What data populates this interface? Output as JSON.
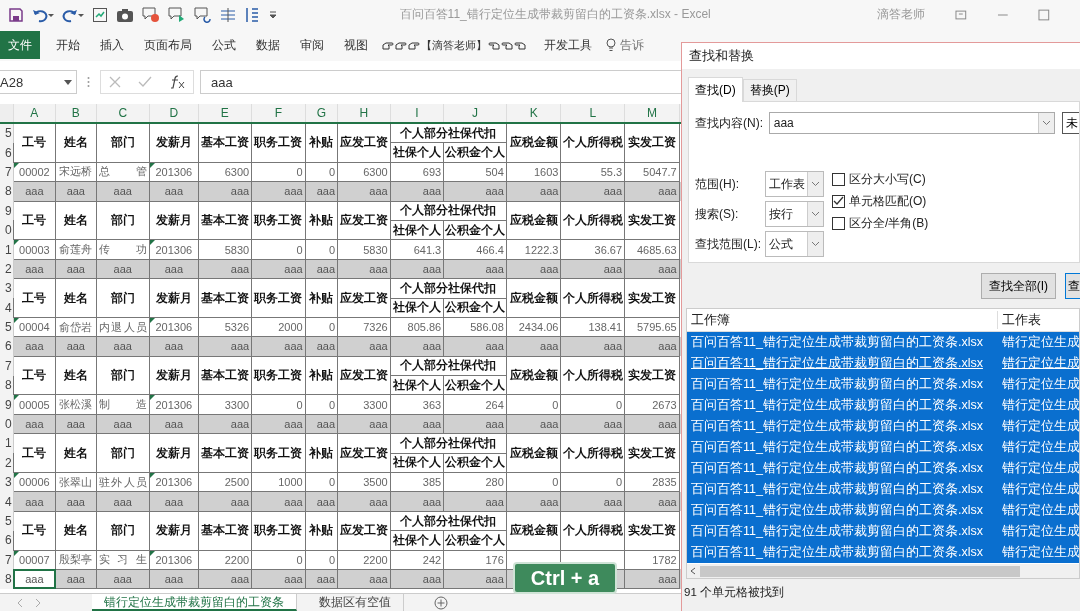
{
  "title_bar": {
    "file_title": "百问百答11_错行定位生成带裁剪留白的工资条.xlsx  -  Excel",
    "user": "滴答老师"
  },
  "ribbon_tabs": [
    {
      "label": "文件",
      "kind": "file"
    },
    {
      "label": "开始",
      "kind": "plain"
    },
    {
      "label": "插入",
      "kind": "plain"
    },
    {
      "label": "页面布局",
      "kind": "plain"
    },
    {
      "label": "公式",
      "kind": "plain"
    },
    {
      "label": "数据",
      "kind": "plain"
    },
    {
      "label": "审阅",
      "kind": "plain"
    },
    {
      "label": "视图",
      "kind": "plain"
    },
    {
      "label": "【滴答老师】",
      "kind": "custom"
    },
    {
      "label": "开发工具",
      "kind": "plain"
    },
    {
      "label": "告诉",
      "kind": "search"
    }
  ],
  "formula_bar": {
    "name_box": "A28",
    "formula": "aaa"
  },
  "sheet": {
    "columns": [
      "A",
      "B",
      "C",
      "D",
      "E",
      "F",
      "G",
      "H",
      "I",
      "J",
      "K",
      "L",
      "M"
    ],
    "blocks": [
      {
        "row_numbers": [
          "5",
          "6",
          "7",
          "8"
        ],
        "header_top": [
          "工号",
          "姓名",
          "部门",
          "发薪月",
          "基本工资",
          "职务工资",
          "补贴",
          "应发工资",
          "个人部分社保代扣",
          "应税金额",
          "个人所得税",
          "实发工资"
        ],
        "header_bottom": [
          "社保个人",
          "公积金个人"
        ],
        "data": {
          "A": "00002",
          "B": "宋远桥",
          "C": "总管",
          "D": "201306",
          "E": "6300",
          "F": "0",
          "G": "0",
          "H": "6300",
          "I": "693",
          "J": "504",
          "K": "1603",
          "L": "55.3",
          "M": "5047.7"
        },
        "filler": {
          "A": "aaa",
          "B": "aaa",
          "C": "aaa",
          "D": "aaa",
          "E": "aaa",
          "F": "aaa",
          "G": "aaa",
          "H": "aaa",
          "I": "aaa",
          "J": "aaa",
          "K": "aaa",
          "L": "aaa",
          "M": "aaa"
        },
        "filler_first_selected": false
      },
      {
        "row_numbers": [
          "9",
          "0",
          "1",
          "2"
        ],
        "header_top": [
          "工号",
          "姓名",
          "部门",
          "发薪月",
          "基本工资",
          "职务工资",
          "补贴",
          "应发工资",
          "个人部分社保代扣",
          "应税金额",
          "个人所得税",
          "实发工资"
        ],
        "header_bottom": [
          "社保个人",
          "公积金个人"
        ],
        "data": {
          "A": "00003",
          "B": "俞莲舟",
          "C": "传功",
          "D": "201306",
          "E": "5830",
          "F": "0",
          "G": "0",
          "H": "5830",
          "I": "641.3",
          "J": "466.4",
          "K": "1222.3",
          "L": "36.67",
          "M": "4685.63"
        },
        "filler": {
          "A": "aaa",
          "B": "aaa",
          "C": "aaa",
          "D": "aaa",
          "E": "aaa",
          "F": "aaa",
          "G": "aaa",
          "H": "aaa",
          "I": "aaa",
          "J": "aaa",
          "K": "aaa",
          "L": "aaa",
          "M": "aaa"
        },
        "filler_first_selected": false
      },
      {
        "row_numbers": [
          "3",
          "4",
          "5",
          "6"
        ],
        "header_top": [
          "工号",
          "姓名",
          "部门",
          "发薪月",
          "基本工资",
          "职务工资",
          "补贴",
          "应发工资",
          "个人部分社保代扣",
          "应税金额",
          "个人所得税",
          "实发工资"
        ],
        "header_bottom": [
          "社保个人",
          "公积金个人"
        ],
        "data": {
          "A": "00004",
          "B": "俞岱岩",
          "C": "内退人员",
          "D": "201306",
          "E": "5326",
          "F": "2000",
          "G": "0",
          "H": "7326",
          "I": "805.86",
          "J": "586.08",
          "K": "2434.06",
          "L": "138.41",
          "M": "5795.65"
        },
        "filler": {
          "A": "aaa",
          "B": "aaa",
          "C": "aaa",
          "D": "aaa",
          "E": "aaa",
          "F": "aaa",
          "G": "aaa",
          "H": "aaa",
          "I": "aaa",
          "J": "aaa",
          "K": "aaa",
          "L": "aaa",
          "M": "aaa"
        },
        "filler_first_selected": false
      },
      {
        "row_numbers": [
          "7",
          "8",
          "9",
          "0"
        ],
        "header_top": [
          "工号",
          "姓名",
          "部门",
          "发薪月",
          "基本工资",
          "职务工资",
          "补贴",
          "应发工资",
          "个人部分社保代扣",
          "应税金额",
          "个人所得税",
          "实发工资"
        ],
        "header_bottom": [
          "社保个人",
          "公积金个人"
        ],
        "data": {
          "A": "00005",
          "B": "张松溪",
          "C": "制造",
          "D": "201306",
          "E": "3300",
          "F": "0",
          "G": "0",
          "H": "3300",
          "I": "363",
          "J": "264",
          "K": "0",
          "L": "0",
          "M": "2673"
        },
        "filler": {
          "A": "aaa",
          "B": "aaa",
          "C": "aaa",
          "D": "aaa",
          "E": "aaa",
          "F": "aaa",
          "G": "aaa",
          "H": "aaa",
          "I": "aaa",
          "J": "aaa",
          "K": "aaa",
          "L": "aaa",
          "M": "aaa"
        },
        "filler_first_selected": false
      },
      {
        "row_numbers": [
          "1",
          "2",
          "3",
          "4"
        ],
        "header_top": [
          "工号",
          "姓名",
          "部门",
          "发薪月",
          "基本工资",
          "职务工资",
          "补贴",
          "应发工资",
          "个人部分社保代扣",
          "应税金额",
          "个人所得税",
          "实发工资"
        ],
        "header_bottom": [
          "社保个人",
          "公积金个人"
        ],
        "data": {
          "A": "00006",
          "B": "张翠山",
          "C": "驻外人员",
          "D": "201306",
          "E": "2500",
          "F": "1000",
          "G": "0",
          "H": "3500",
          "I": "385",
          "J": "280",
          "K": "0",
          "L": "0",
          "M": "2835"
        },
        "filler": {
          "A": "aaa",
          "B": "aaa",
          "C": "aaa",
          "D": "aaa",
          "E": "aaa",
          "F": "aaa",
          "G": "aaa",
          "H": "aaa",
          "I": "aaa",
          "J": "aaa",
          "K": "aaa",
          "L": "aaa",
          "M": "aaa"
        },
        "filler_first_selected": false
      },
      {
        "row_numbers": [
          "5",
          "6",
          "7",
          "8"
        ],
        "header_top": [
          "工号",
          "姓名",
          "部门",
          "发薪月",
          "基本工资",
          "职务工资",
          "补贴",
          "应发工资",
          "个人部分社保代扣",
          "应税金额",
          "个人所得税",
          "实发工资"
        ],
        "header_bottom": [
          "社保个人",
          "公积金个人"
        ],
        "data": {
          "A": "00007",
          "B": "殷梨亭",
          "C": "实习生",
          "D": "201306",
          "E": "2200",
          "F": "0",
          "G": "0",
          "H": "2200",
          "I": "242",
          "J": "176",
          "M": "1782"
        },
        "filler": {
          "A": "aaa",
          "B": "aaa",
          "C": "aaa",
          "D": "aaa",
          "E": "aaa",
          "F": "aaa",
          "G": "aaa",
          "H": "aaa",
          "I": "aaa",
          "J": "aaa",
          "M": "aaa"
        },
        "filler_first_selected": true
      }
    ]
  },
  "sheet_tabs": [
    {
      "label": "错行定位生成带裁剪留白的工资条",
      "selected": true
    },
    {
      "label": "数据区有空值",
      "selected": false
    }
  ],
  "key_hint": "Ctrl + a",
  "dialog": {
    "title": "查找和替换",
    "tabs": [
      {
        "label": "查找(D)",
        "selected": true
      },
      {
        "label": "替换(P)",
        "selected": false
      }
    ],
    "find_label": "查找内容(N):",
    "find_value": "aaa",
    "format_button": "未",
    "options": [
      {
        "label": "范围(H):",
        "value": "工作表"
      },
      {
        "label": "搜索(S):",
        "value": "按行"
      },
      {
        "label": "查找范围(L):",
        "value": "公式"
      }
    ],
    "checkboxes": [
      {
        "label": "区分大小写(C)",
        "checked": false
      },
      {
        "label": "单元格匹配(O)",
        "checked": true
      },
      {
        "label": "区分全/半角(B)",
        "checked": false
      }
    ],
    "buttons": [
      "查找全部(I)",
      "查"
    ],
    "results": {
      "columns": [
        "工作簿",
        "工作表"
      ],
      "rows": [
        {
          "workbook": "百问百答11_错行定位生成带裁剪留白的工资条.xlsx",
          "worksheet": "错行定位生成",
          "selected": true,
          "hovered": false
        },
        {
          "workbook": "百问百答11_错行定位生成带裁剪留白的工资条.xlsx",
          "worksheet": "错行定位生成",
          "selected": true,
          "hovered": true
        },
        {
          "workbook": "百问百答11_错行定位生成带裁剪留白的工资条.xlsx",
          "worksheet": "错行定位生成",
          "selected": true,
          "hovered": false
        },
        {
          "workbook": "百问百答11_错行定位生成带裁剪留白的工资条.xlsx",
          "worksheet": "错行定位生成",
          "selected": true,
          "hovered": false
        },
        {
          "workbook": "百问百答11_错行定位生成带裁剪留白的工资条.xlsx",
          "worksheet": "错行定位生成",
          "selected": true,
          "hovered": false
        },
        {
          "workbook": "百问百答11_错行定位生成带裁剪留白的工资条.xlsx",
          "worksheet": "错行定位生成",
          "selected": true,
          "hovered": false
        },
        {
          "workbook": "百问百答11_错行定位生成带裁剪留白的工资条.xlsx",
          "worksheet": "错行定位生成",
          "selected": true,
          "hovered": false
        },
        {
          "workbook": "百问百答11_错行定位生成带裁剪留白的工资条.xlsx",
          "worksheet": "错行定位生成",
          "selected": true,
          "hovered": false
        },
        {
          "workbook": "百问百答11_错行定位生成带裁剪留白的工资条.xlsx",
          "worksheet": "错行定位生成",
          "selected": true,
          "hovered": false
        },
        {
          "workbook": "百问百答11_错行定位生成带裁剪留白的工资条.xlsx",
          "worksheet": "错行定位生成",
          "selected": true,
          "hovered": false
        },
        {
          "workbook": "百问百答11_错行定位生成带裁剪留白的工资条.xlsx",
          "worksheet": "错行定位生成",
          "selected": true,
          "hovered": false
        }
      ]
    },
    "status": "91 个单元格被找到"
  }
}
